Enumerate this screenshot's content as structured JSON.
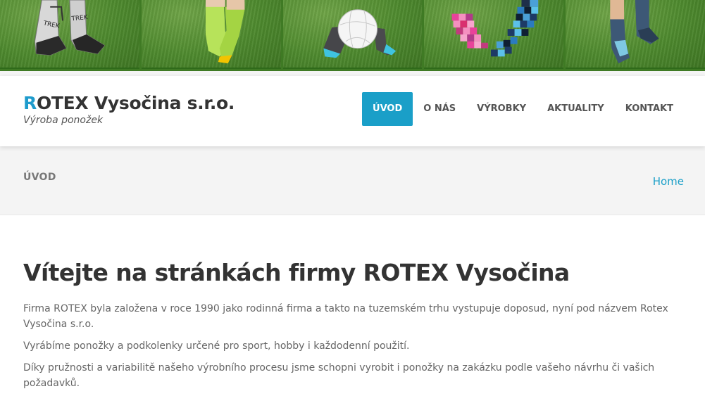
{
  "site": {
    "brand_first_letter": "R",
    "brand_rest": "OTEX Vysočina s.r.o.",
    "tagline": "Výroba ponožek",
    "accent_color": "#1a9fc8"
  },
  "banner": {
    "photos": [
      "grey-trek-socks-photo",
      "lime-socks-photo",
      "football-socks-photo",
      "checkered-socks-photo",
      "blue-socks-photo"
    ]
  },
  "nav": {
    "items": [
      {
        "label": "ÚVOD",
        "active": true
      },
      {
        "label": "O NÁS",
        "active": false
      },
      {
        "label": "VÝROBKY",
        "active": false
      },
      {
        "label": "AKTUALITY",
        "active": false
      },
      {
        "label": "KONTAKT",
        "active": false
      }
    ]
  },
  "page_bar": {
    "title": "ÚVOD",
    "breadcrumb": "Home"
  },
  "main": {
    "heading": "Vítejte na stránkách firmy ROTEX Vysočina",
    "paragraphs": [
      "Firma ROTEX byla založena v roce 1990 jako rodinná firma a takto na tuzemském trhu vystupuje doposud, nyní pod názvem Rotex Vysočina s.r.o.",
      "Vyrábíme ponožky a podkolenky určené pro sport, hobby i každodenní použití.",
      "Díky pružnosti a variabilitě našeho výrobního procesu jsme schopni vyrobit i ponožky na zakázku podle vašeho návrhu či vašich požadavků."
    ]
  }
}
